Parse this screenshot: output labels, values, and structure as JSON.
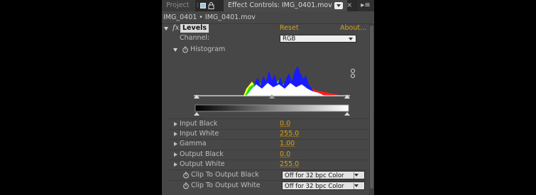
{
  "tabs": {
    "project_label": "Project",
    "effect_controls_label": "Effect Controls: IMG_0401.mov"
  },
  "header": {
    "title": "IMG_0401 • IMG_0401.mov"
  },
  "effect": {
    "fx_label": "fx",
    "name": "Levels",
    "reset_label": "Reset",
    "about_label": "About..."
  },
  "channel": {
    "label": "Channel:",
    "value": "RGB"
  },
  "histogram": {
    "label": "Histogram"
  },
  "properties": [
    {
      "label": "Input Black",
      "value": "0.0"
    },
    {
      "label": "Input White",
      "value": "255.0"
    },
    {
      "label": "Gamma",
      "value": "1.00"
    },
    {
      "label": "Output Black",
      "value": "0.0"
    },
    {
      "label": "Output White",
      "value": "255.0"
    }
  ],
  "clip_black": {
    "label": "Clip To Output Black",
    "value": "Off for 32 bpc Color"
  },
  "clip_white": {
    "label": "Clip To Output White",
    "value": "Off for 32 bpc Color"
  },
  "colors": {
    "accent_link": "#d9a114",
    "histogram_red": "#ff1a1a",
    "histogram_green": "#22dd22",
    "histogram_blue": "#1a1aff",
    "histogram_yellow": "#ffff22"
  }
}
